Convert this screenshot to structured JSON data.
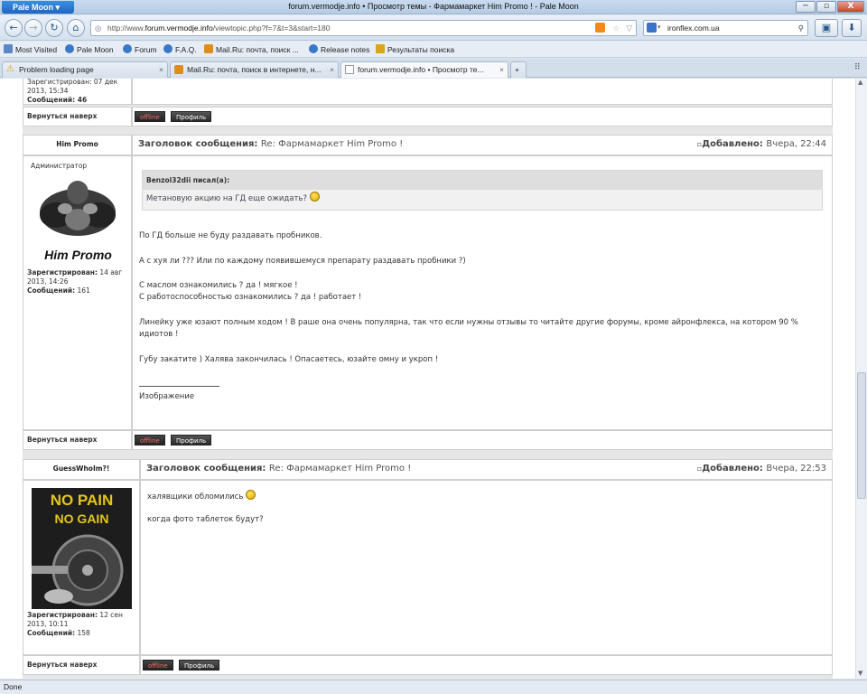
{
  "window": {
    "app_button": "Pale Moon",
    "title": "forum.vermodje.info • Просмотр темы - Фармамаркет Him Promo ! - Pale Moon",
    "min": "─",
    "max": "▫",
    "close": "X"
  },
  "nav": {
    "url_prefix": "http://www.",
    "url_host": "forum.vermodje.info",
    "url_rest": "/viewtopic.php?f=7&t=3&start=180",
    "search_value": "ironflex.com.ua"
  },
  "bookmarks": [
    {
      "label": "Most Visited"
    },
    {
      "label": "Pale Moon"
    },
    {
      "label": "Forum"
    },
    {
      "label": "F.A.Q."
    },
    {
      "label": "Mail.Ru: почта, поиск ..."
    },
    {
      "label": "Release notes"
    },
    {
      "label": "Результаты поиска"
    }
  ],
  "tabs": [
    {
      "label": "Problem loading page"
    },
    {
      "label": "Mail.Ru: почта, поиск в интернете, н..."
    },
    {
      "label": "forum.vermodje.info • Просмотр те..."
    }
  ],
  "top_partial": {
    "registered_line1": "Зарегистрирован: 07 дек",
    "registered_line2": "2013, 15:34",
    "messages": "Сообщений: 46"
  },
  "labels": {
    "back_to_top": "Вернуться наверх",
    "offline": "offline",
    "profile": "Профиль",
    "subject_label": "Заголовок сообщения:",
    "added_label": "Добавлено:",
    "registered": "Зарегистрирован:",
    "messages": "Сообщений:"
  },
  "posts": [
    {
      "author": "Him Promo",
      "rank": "Администратор",
      "avatar_text": "Him Promo",
      "registered_1": "14 авг",
      "registered_2": "2013, 14:26",
      "messages": "161",
      "subject": "Re: Фармамаркет Him Promo !",
      "added": "Вчера, 22:44",
      "quote_author": "Benzol32dii писал(а):",
      "quote_text": "Метановую акцию на ГД еще ожидать?",
      "lines": [
        "По ГД больше не буду раздавать пробников.",
        "А с хуя ли ??? Или по каждому появившемуся препарату раздавать пробники ?)",
        "С маслом ознакомились ? да ! мягкое !",
        "С работоспособностью ознакомились ? да ! работает !",
        "Линейку уже юзают полным ходом ! В раше она очень популярна, так что если нужны отзывы то читайте другие форумы, кроме айронфлекса, на котором 90 %",
        "идиотов !",
        "Губу закатите ) Халява закончилась ! Опасаетесь, юзайте омну и укроп !"
      ],
      "signature": "Изображение"
    },
    {
      "author": "GuessWhoIm?!",
      "avatar_line1": "NO PAIN",
      "avatar_line2": "NO GAIN",
      "registered_1": "12 сен",
      "registered_2": "2013, 10:11",
      "messages": "158",
      "subject": "Re: Фармамаркет Him Promo !",
      "added": "Вчера, 22:53",
      "lines": [
        "халявщики обломились",
        "когда фото таблеток будут?"
      ]
    }
  ],
  "status": "Done",
  "colors": {
    "offline_text": "#ff6b6b",
    "accent": "#1f66c4"
  }
}
